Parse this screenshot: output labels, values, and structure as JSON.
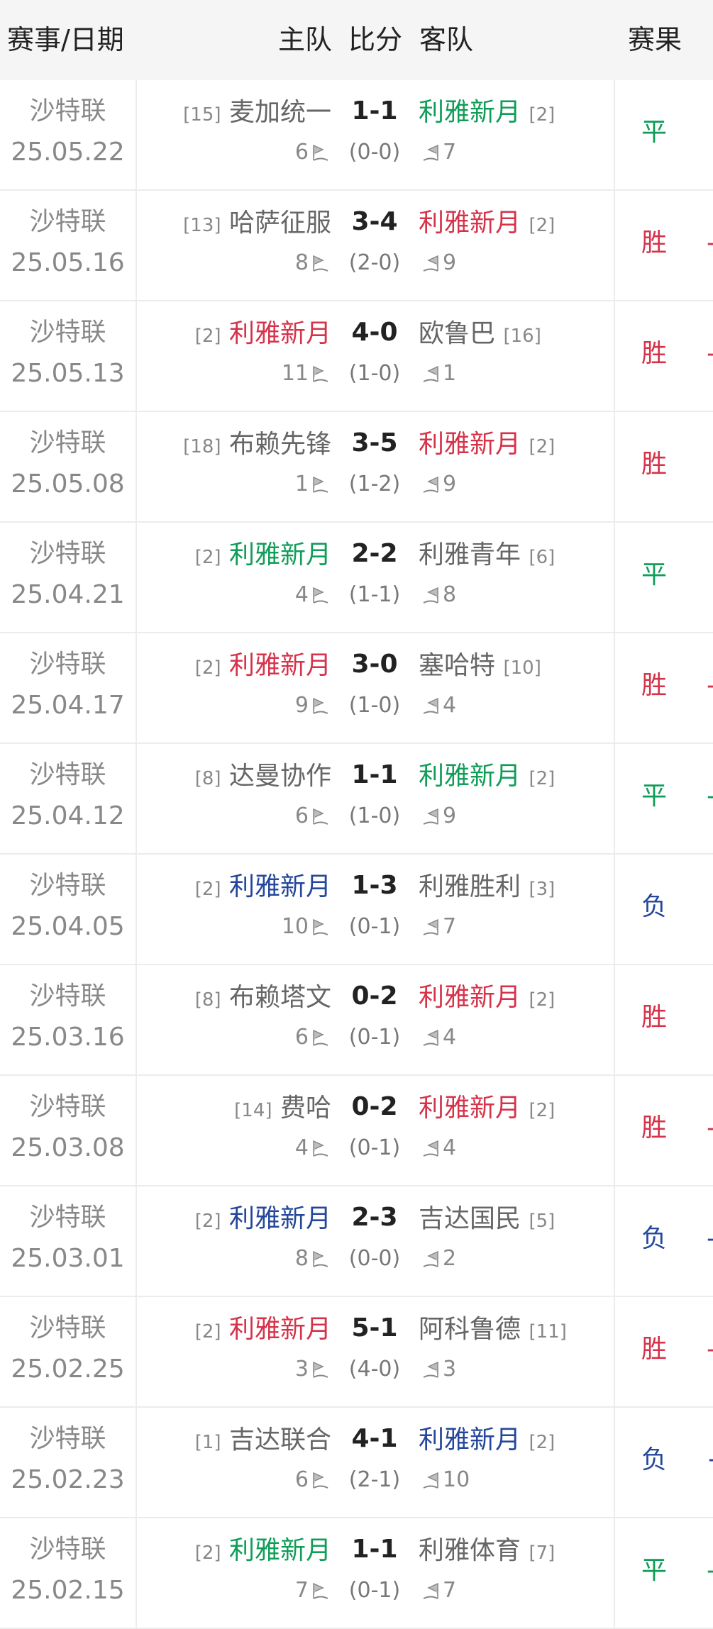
{
  "header": {
    "col_event_date": "赛事/日期",
    "col_home": "主队",
    "col_score": "比分",
    "col_away": "客队",
    "col_result": "赛果"
  },
  "colors": {
    "draw": "#0f9d58",
    "win": "#d6334a",
    "loss": "#24479c",
    "neutral": "#666666"
  },
  "icons": {
    "corner": "corner-flag-icon"
  },
  "matches": [
    {
      "league": "沙特联",
      "date": "25.05.22",
      "home_rank": "[15]",
      "home": "麦加统一",
      "home_color": "gray",
      "score": "1-1",
      "away": "利雅新月",
      "away_rank": "[2]",
      "away_color": "green",
      "half": "(0-0)",
      "home_corners": "6",
      "away_corners": "7",
      "result": "平",
      "result_color": "green",
      "edge": ""
    },
    {
      "league": "沙特联",
      "date": "25.05.16",
      "home_rank": "[13]",
      "home": "哈萨征服",
      "home_color": "gray",
      "score": "3-4",
      "away": "利雅新月",
      "away_rank": "[2]",
      "away_color": "red",
      "half": "(2-0)",
      "home_corners": "8",
      "away_corners": "9",
      "result": "胜",
      "result_color": "red",
      "edge": "-"
    },
    {
      "league": "沙特联",
      "date": "25.05.13",
      "home_rank": "[2]",
      "home": "利雅新月",
      "home_color": "red",
      "score": "4-0",
      "away": "欧鲁巴",
      "away_rank": "[16]",
      "away_color": "gray",
      "half": "(1-0)",
      "home_corners": "11",
      "away_corners": "1",
      "result": "胜",
      "result_color": "red",
      "edge": "-"
    },
    {
      "league": "沙特联",
      "date": "25.05.08",
      "home_rank": "[18]",
      "home": "布赖先锋",
      "home_color": "gray",
      "score": "3-5",
      "away": "利雅新月",
      "away_rank": "[2]",
      "away_color": "red",
      "half": "(1-2)",
      "home_corners": "1",
      "away_corners": "9",
      "result": "胜",
      "result_color": "red",
      "edge": ""
    },
    {
      "league": "沙特联",
      "date": "25.04.21",
      "home_rank": "[2]",
      "home": "利雅新月",
      "home_color": "green",
      "score": "2-2",
      "away": "利雅青年",
      "away_rank": "[6]",
      "away_color": "gray",
      "half": "(1-1)",
      "home_corners": "4",
      "away_corners": "8",
      "result": "平",
      "result_color": "green",
      "edge": ""
    },
    {
      "league": "沙特联",
      "date": "25.04.17",
      "home_rank": "[2]",
      "home": "利雅新月",
      "home_color": "red",
      "score": "3-0",
      "away": "塞哈特",
      "away_rank": "[10]",
      "away_color": "gray",
      "half": "(1-0)",
      "home_corners": "9",
      "away_corners": "4",
      "result": "胜",
      "result_color": "red",
      "edge": "-"
    },
    {
      "league": "沙特联",
      "date": "25.04.12",
      "home_rank": "[8]",
      "home": "达曼协作",
      "home_color": "gray",
      "score": "1-1",
      "away": "利雅新月",
      "away_rank": "[2]",
      "away_color": "green",
      "half": "(1-0)",
      "home_corners": "6",
      "away_corners": "9",
      "result": "平",
      "result_color": "green",
      "edge": "-"
    },
    {
      "league": "沙特联",
      "date": "25.04.05",
      "home_rank": "[2]",
      "home": "利雅新月",
      "home_color": "blue",
      "score": "1-3",
      "away": "利雅胜利",
      "away_rank": "[3]",
      "away_color": "gray",
      "half": "(0-1)",
      "home_corners": "10",
      "away_corners": "7",
      "result": "负",
      "result_color": "blue",
      "edge": ""
    },
    {
      "league": "沙特联",
      "date": "25.03.16",
      "home_rank": "[8]",
      "home": "布赖塔文",
      "home_color": "gray",
      "score": "0-2",
      "away": "利雅新月",
      "away_rank": "[2]",
      "away_color": "red",
      "half": "(0-1)",
      "home_corners": "6",
      "away_corners": "4",
      "result": "胜",
      "result_color": "red",
      "edge": ""
    },
    {
      "league": "沙特联",
      "date": "25.03.08",
      "home_rank": "[14]",
      "home": "费哈",
      "home_color": "gray",
      "score": "0-2",
      "away": "利雅新月",
      "away_rank": "[2]",
      "away_color": "red",
      "half": "(0-1)",
      "home_corners": "4",
      "away_corners": "4",
      "result": "胜",
      "result_color": "red",
      "edge": "-"
    },
    {
      "league": "沙特联",
      "date": "25.03.01",
      "home_rank": "[2]",
      "home": "利雅新月",
      "home_color": "blue",
      "score": "2-3",
      "away": "吉达国民",
      "away_rank": "[5]",
      "away_color": "gray",
      "half": "(0-0)",
      "home_corners": "8",
      "away_corners": "2",
      "result": "负",
      "result_color": "blue",
      "edge": "-"
    },
    {
      "league": "沙特联",
      "date": "25.02.25",
      "home_rank": "[2]",
      "home": "利雅新月",
      "home_color": "red",
      "score": "5-1",
      "away": "阿科鲁德",
      "away_rank": "[11]",
      "away_color": "gray",
      "half": "(4-0)",
      "home_corners": "3",
      "away_corners": "3",
      "result": "胜",
      "result_color": "red",
      "edge": "-"
    },
    {
      "league": "沙特联",
      "date": "25.02.23",
      "home_rank": "[1]",
      "home": "吉达联合",
      "home_color": "gray",
      "score": "4-1",
      "away": "利雅新月",
      "away_rank": "[2]",
      "away_color": "blue",
      "half": "(2-1)",
      "home_corners": "6",
      "away_corners": "10",
      "result": "负",
      "result_color": "blue",
      "edge": "+"
    },
    {
      "league": "沙特联",
      "date": "25.02.15",
      "home_rank": "[2]",
      "home": "利雅新月",
      "home_color": "green",
      "score": "1-1",
      "away": "利雅体育",
      "away_rank": "[7]",
      "away_color": "gray",
      "half": "(0-1)",
      "home_corners": "7",
      "away_corners": "7",
      "result": "平",
      "result_color": "green",
      "edge": "-"
    }
  ]
}
